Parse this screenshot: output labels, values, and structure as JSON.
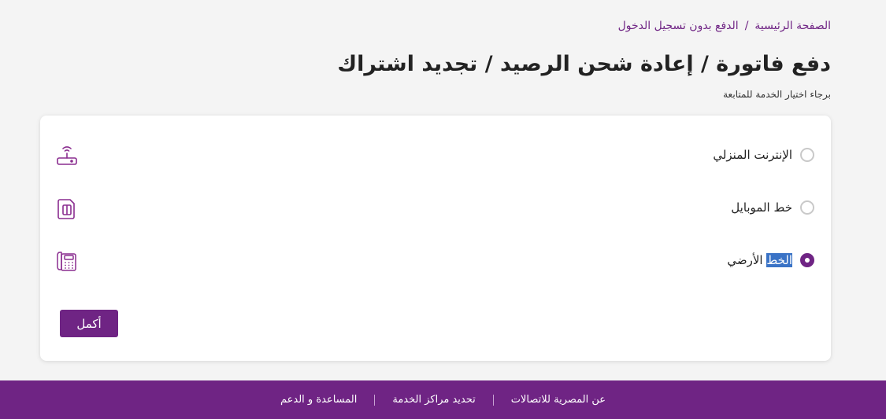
{
  "breadcrumb": {
    "home": "الصفحة الرئيسية",
    "separator": "/",
    "current": "الدفع بدون تسجيل الدخول"
  },
  "page": {
    "title": "دفع فاتورة / إعادة شحن الرصيد / تجديد اشتراك",
    "subtitle": "برجاء اختيار الخدمة للمتابعة"
  },
  "options": [
    {
      "label": "الإنترنت المنزلي",
      "icon": "router-icon",
      "selected": false
    },
    {
      "label": "خط الموبايل",
      "icon": "sim-card-icon",
      "selected": false
    },
    {
      "label_highlight": "الخط",
      "label_rest": " الأرضي",
      "icon": "landline-phone-icon",
      "selected": true
    }
  ],
  "continue_button": "أكمل",
  "footer": {
    "about": "عن المصرية للاتصالات",
    "locate": "تحديد مراكز الخدمة",
    "help": "المساعدة و الدعم"
  },
  "colors": {
    "brand": "#6f2484",
    "highlight": "#3a73c6"
  }
}
